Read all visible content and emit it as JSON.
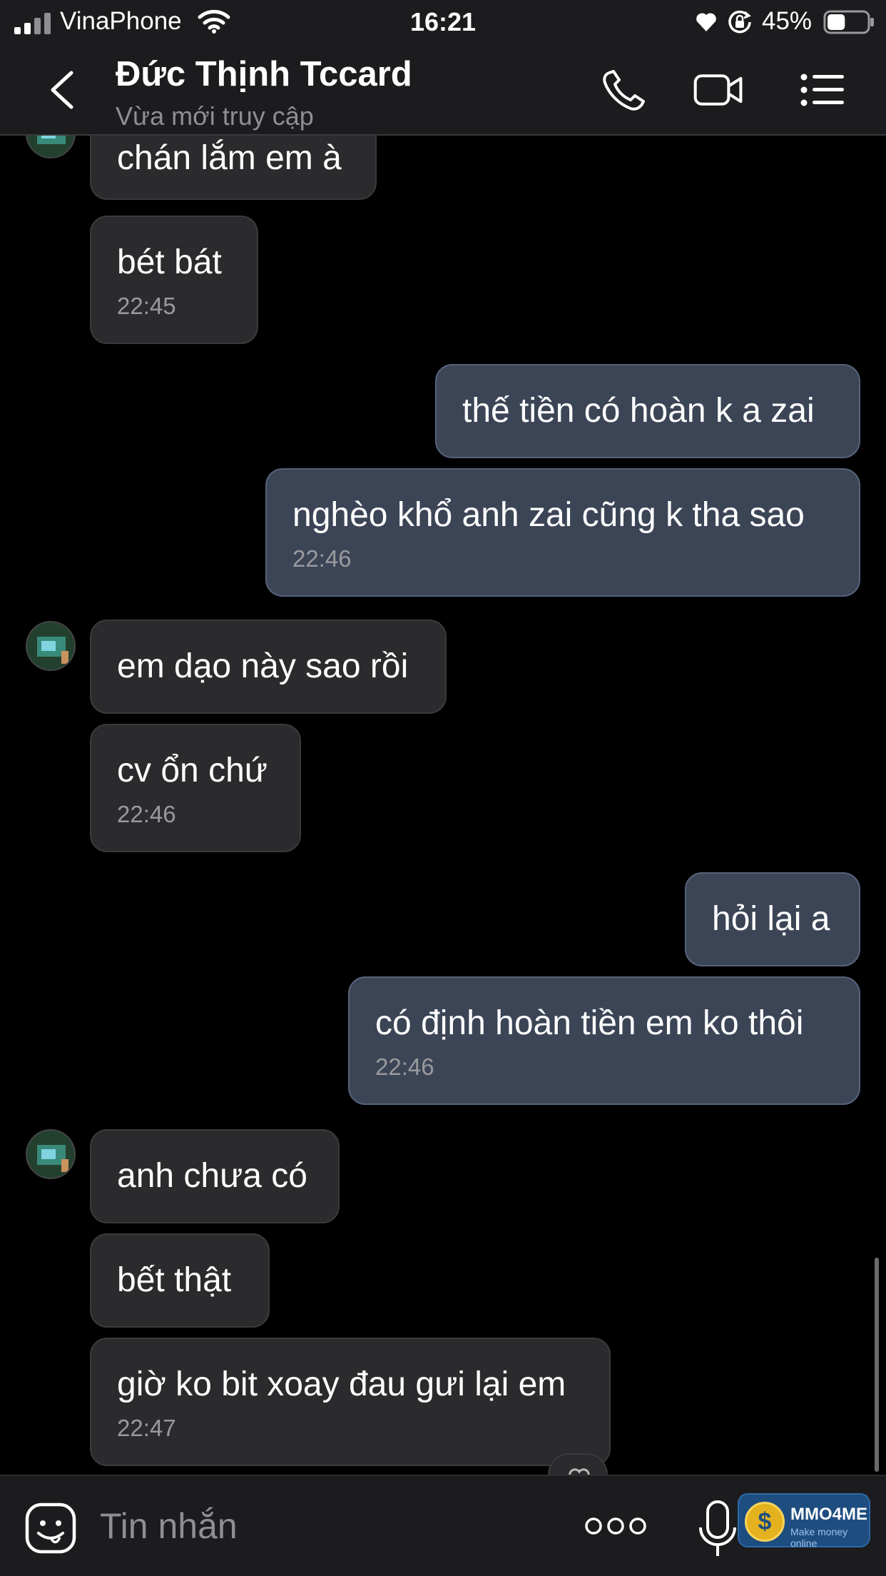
{
  "status_bar": {
    "carrier": "VinaPhone",
    "time": "16:21",
    "battery_percent": "45%",
    "battery_level": 0.45,
    "icons": [
      "signal-icon",
      "wifi-icon",
      "heart-icon",
      "rotation-lock-icon",
      "battery-icon"
    ]
  },
  "header": {
    "contact_name": "Đức Thịnh Tccard",
    "contact_status": "Vừa mới truy cập",
    "icons": [
      "back-icon",
      "phone-icon",
      "video-call-icon",
      "menu-icon"
    ]
  },
  "messages": [
    {
      "side": "in",
      "text": "chán lắm em à",
      "time": ""
    },
    {
      "side": "in",
      "text": "bét bát",
      "time": "22:45"
    },
    {
      "side": "out",
      "text": "thế tiền có hoàn k a zai",
      "time": ""
    },
    {
      "side": "out",
      "text": "nghèo khổ anh zai cũng k tha sao",
      "time": "22:46"
    },
    {
      "side": "in",
      "text": "em dạo này sao rồi",
      "time": ""
    },
    {
      "side": "in",
      "text": "cv ổn chứ",
      "time": "22:46"
    },
    {
      "side": "out",
      "text": "hỏi lại a",
      "time": ""
    },
    {
      "side": "out",
      "text": "có định hoàn tiền em ko thôi",
      "time": "22:46"
    },
    {
      "side": "in",
      "text": "anh chưa có",
      "time": ""
    },
    {
      "side": "in",
      "text": "bết thật",
      "time": ""
    },
    {
      "side": "in",
      "text": "giờ ko bit xoay đau gưi lại em",
      "time": "22:47"
    }
  ],
  "input": {
    "placeholder": "Tin nhắn",
    "icons": [
      "emoji-icon",
      "more-icon",
      "microphone-icon"
    ]
  },
  "watermark": {
    "brand": "MMO4ME",
    "tagline": "Make money online",
    "coin_symbol": "$"
  },
  "colors": {
    "background": "#000000",
    "bar": "#1c1c1e",
    "incoming_bubble": "#2b2b2d",
    "outgoing_bubble": "#3b4556",
    "muted_text": "#8e8e93"
  }
}
